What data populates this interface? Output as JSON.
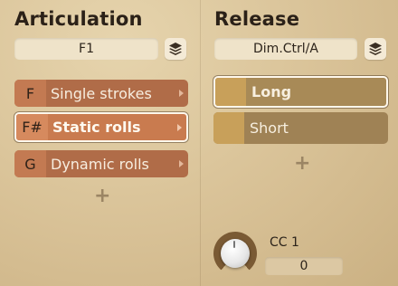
{
  "articulation": {
    "title": "Articulation",
    "selector_value": "F1",
    "layers_icon": "layers-icon",
    "items": [
      {
        "key": "F",
        "label": "Single strokes",
        "selected": false
      },
      {
        "key": "F#",
        "label": "Static rolls",
        "selected": true
      },
      {
        "key": "G",
        "label": "Dynamic rolls",
        "selected": false
      }
    ],
    "add_label": "+"
  },
  "release": {
    "title": "Release",
    "selector_value": "Dim.Ctrl/A",
    "layers_icon": "layers-icon",
    "items": [
      {
        "label": "Long",
        "selected": true
      },
      {
        "label": "Short",
        "selected": false
      }
    ],
    "add_label": "+"
  },
  "cc": {
    "label": "CC 1",
    "value": "0"
  },
  "colors": {
    "background": "#d8c196",
    "articulation_row": "#b06c48",
    "articulation_selected": "#c97b4f",
    "release_row": "#9f8255",
    "release_swatch": "#c8a05a"
  }
}
